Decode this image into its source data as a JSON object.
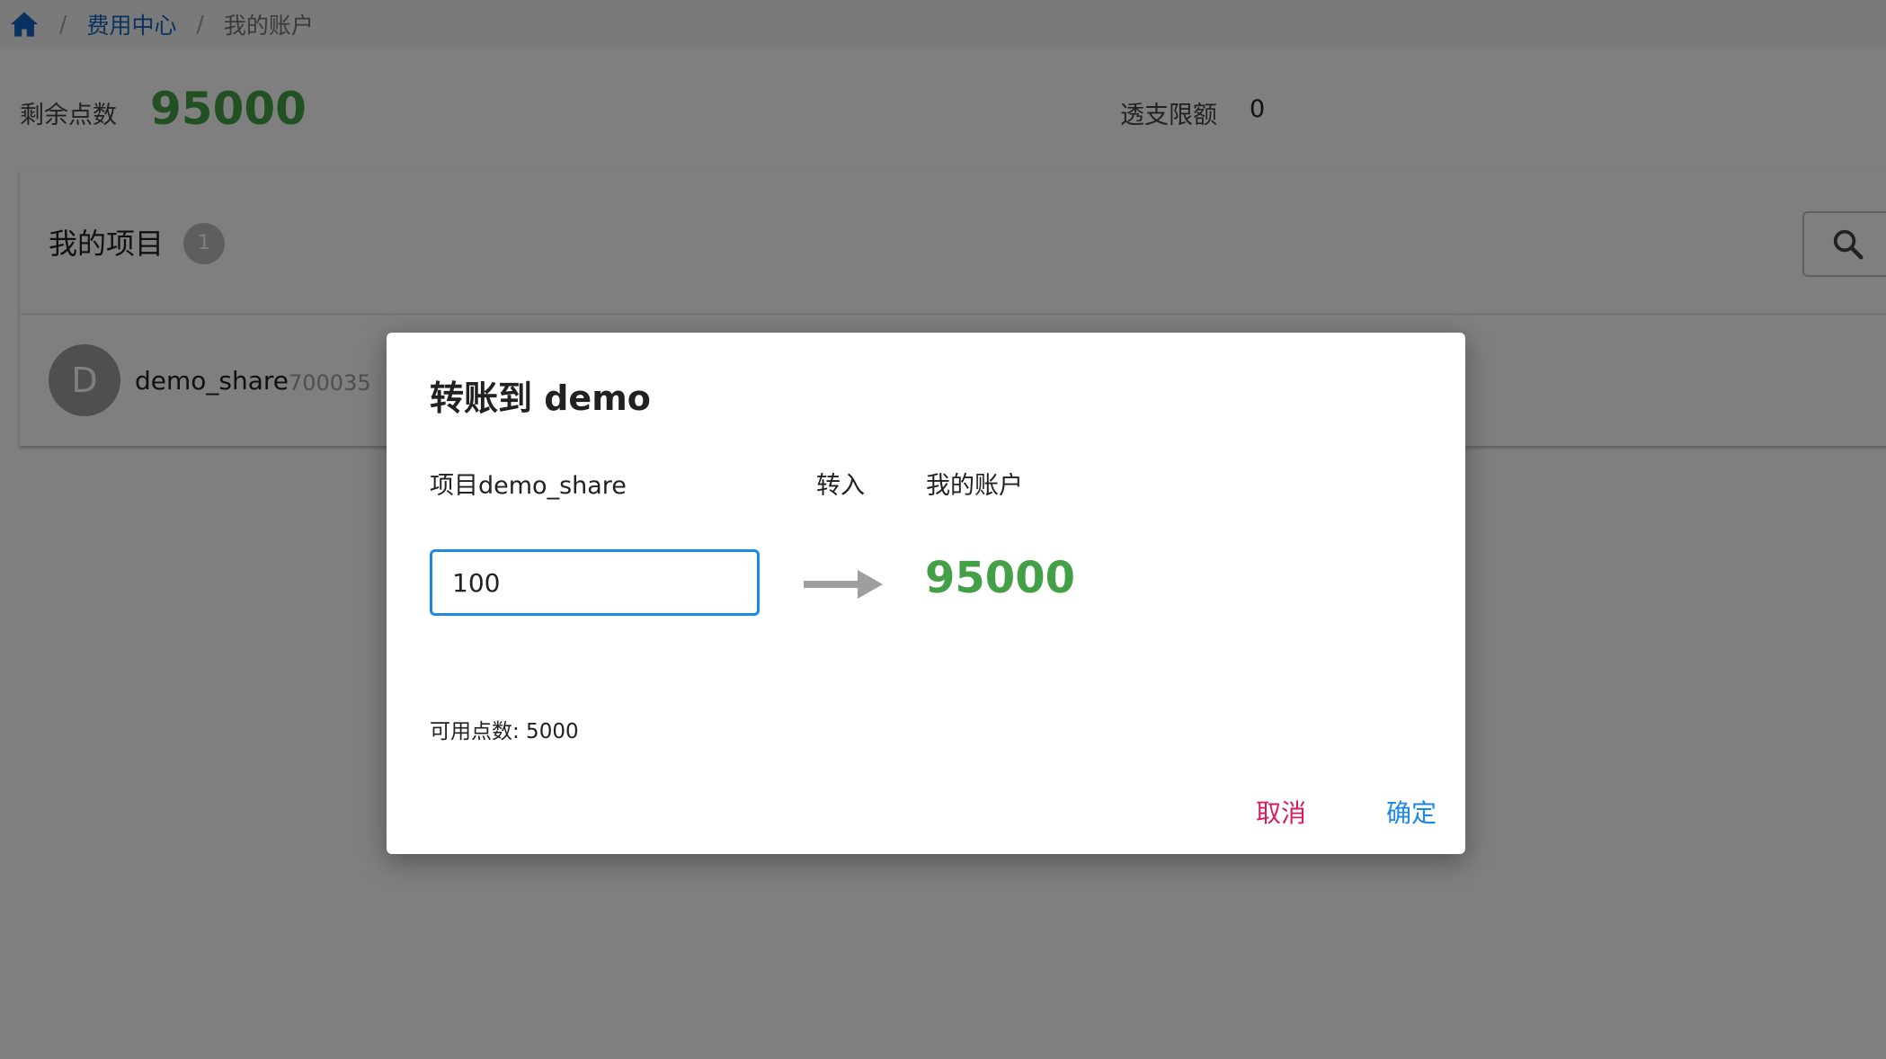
{
  "breadcrumb": {
    "home_icon": "home-icon",
    "separator": "/",
    "items": [
      {
        "label": "费用中心"
      },
      {
        "label": "我的账户"
      }
    ]
  },
  "summary": {
    "remaining_label": "剩余点数",
    "remaining_value": "95000",
    "overdraft_label": "透支限额",
    "overdraft_value": "0"
  },
  "projects": {
    "title": "我的项目",
    "count": "1",
    "search_icon": "search-icon",
    "items": [
      {
        "avatar_letter": "D",
        "name": "demo_share",
        "id": "700035"
      }
    ]
  },
  "dialog": {
    "title": "转账到 demo",
    "from_label": "项目demo_share",
    "direction_label": "转入",
    "to_label": "我的账户",
    "amount_value": "100",
    "arrow_icon": "arrow-right-icon",
    "target_balance": "95000",
    "available_text": "可用点数: 5000",
    "cancel_label": "取消",
    "confirm_label": "确定"
  },
  "colors": {
    "accent_green": "#43a047",
    "link_blue": "#1565c0",
    "focus_blue": "#1e88e5",
    "cancel_pink": "#d81b60"
  }
}
